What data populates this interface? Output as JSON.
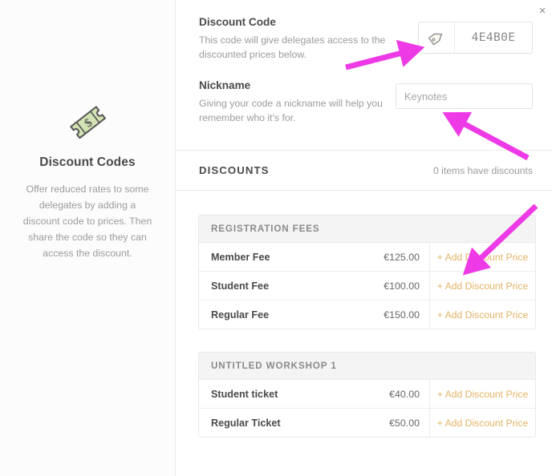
{
  "sidebar": {
    "icon": "coupon-ticket-icon",
    "title": "Discount Codes",
    "description": "Offer reduced rates to some delegates by adding a discount code to prices. Then share the code so they can access the discount."
  },
  "header": {
    "close_label": "×"
  },
  "discount_code": {
    "title": "Discount Code",
    "help": "This code will give delegates access to the discounted prices below.",
    "icon": "price-tag-icon",
    "value": "4E4B0E"
  },
  "nickname": {
    "title": "Nickname",
    "help": "Giving your code a nickname will help you remember who it's for.",
    "value": "",
    "placeholder": "Keynotes"
  },
  "discounts": {
    "title": "DISCOUNTS",
    "count_label": "0 items have discounts",
    "action_label": "+ Add Discount Price",
    "tables": [
      {
        "header": "REGISTRATION FEES",
        "rows": [
          {
            "name": "Member Fee",
            "price": "€125.00",
            "action": "+ Add Discount Price"
          },
          {
            "name": "Student Fee",
            "price": "€100.00",
            "action": "+ Add Discount Price"
          },
          {
            "name": "Regular Fee",
            "price": "€150.00",
            "action": "+ Add Discount Price"
          }
        ]
      },
      {
        "header": "UNTITLED WORKSHOP 1",
        "rows": [
          {
            "name": "Student ticket",
            "price": "€40.00",
            "action": "+ Add Discount Price"
          },
          {
            "name": "Regular Ticket",
            "price": "€50.00",
            "action": "+ Add Discount Price"
          }
        ]
      }
    ]
  },
  "annotations": {
    "arrow_color": "#ee3ae6",
    "arrows": [
      {
        "name": "arrow-to-discount-code-field"
      },
      {
        "name": "arrow-to-nickname-field"
      },
      {
        "name": "arrow-to-add-discount-price"
      }
    ]
  },
  "colors": {
    "accent_amber": "#e3b365",
    "text_dark": "#4a4a4a",
    "text_muted": "#9b9b9b",
    "panel_border": "#e9e9e9",
    "icon_green": "#cfe0ae"
  }
}
